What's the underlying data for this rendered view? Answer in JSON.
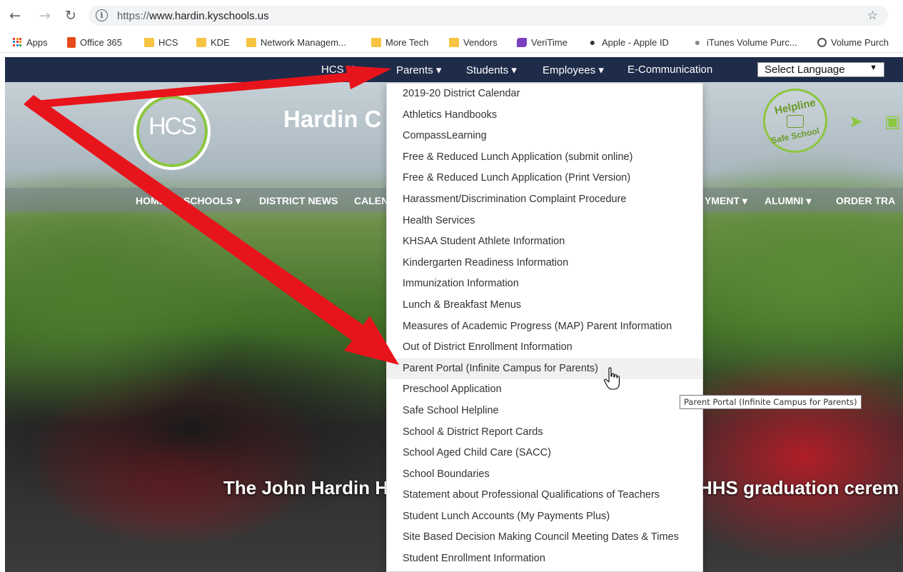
{
  "browser": {
    "url_protocol": "https://",
    "url_host": "www.hardin.kyschools.us",
    "bookmarks": [
      {
        "label": "Apps",
        "icon": "apps-grid-icon"
      },
      {
        "label": "Office 365",
        "icon": "office-icon"
      },
      {
        "label": "HCS",
        "icon": "folder-icon"
      },
      {
        "label": "KDE",
        "icon": "folder-icon"
      },
      {
        "label": "Network Managem...",
        "icon": "folder-icon"
      },
      {
        "label": "More Tech",
        "icon": "folder-icon"
      },
      {
        "label": "Vendors",
        "icon": "folder-icon"
      },
      {
        "label": "VeriTime",
        "icon": "veritime-icon"
      },
      {
        "label": "Apple - Apple ID",
        "icon": "apple-icon"
      },
      {
        "label": "iTunes Volume Purc...",
        "icon": "apple-icon"
      },
      {
        "label": "Volume Purch",
        "icon": "globe-icon"
      }
    ]
  },
  "site": {
    "top_nav": {
      "hcs_home_partial": "HCS H",
      "parents": "Parents",
      "students": "Students",
      "employees": "Employees",
      "ecommunication": "E-Communication",
      "language_select": "Select Language"
    },
    "logo_text": "HCS",
    "title_partial": "Hardin C",
    "helpline": {
      "top": "Helpline",
      "bottom": "Safe School"
    },
    "sub_nav": {
      "home": "HOME",
      "schools": "SCHOOLS",
      "district_news": "DISTRICT NEWS",
      "calendar_partial": "CALEN",
      "employment_partial": "YMENT",
      "alumni": "ALUMNI",
      "order_partial": "ORDER TRA"
    },
    "caption_left": "The John Hardin H",
    "caption_right": "HHS graduation cerem"
  },
  "dropdown": {
    "items": [
      "2019-20 District Calendar",
      "Athletics Handbooks",
      "CompassLearning",
      "Free & Reduced Lunch Application (submit online)",
      "Free & Reduced Lunch Application (Print Version)",
      "Harassment/Discrimination Complaint Procedure",
      "Health Services",
      "KHSAA Student Athlete Information",
      "Kindergarten Readiness Information",
      "Immunization Information",
      "Lunch & Breakfast Menus",
      "Measures of Academic Progress (MAP) Parent Information",
      "Out of District Enrollment Information",
      "Parent Portal (Infinite Campus for Parents)",
      "Preschool Application",
      "Safe School Helpline",
      "School & District Report Cards",
      "School Aged Child Care (SACC)",
      "School Boundaries",
      "Statement about Professional Qualifications of Teachers",
      "Student Lunch Accounts (My Payments Plus)",
      "Site Based Decision Making Council Meeting Dates & Times",
      "Student Enrollment Information"
    ],
    "hovered_index": 13
  },
  "tooltip": "Parent Portal (Infinite Campus for Parents)",
  "colors": {
    "nav_bg": "#1e2c49",
    "accent_green": "#8cc63f",
    "annotation_arrow": "#e8141b"
  }
}
